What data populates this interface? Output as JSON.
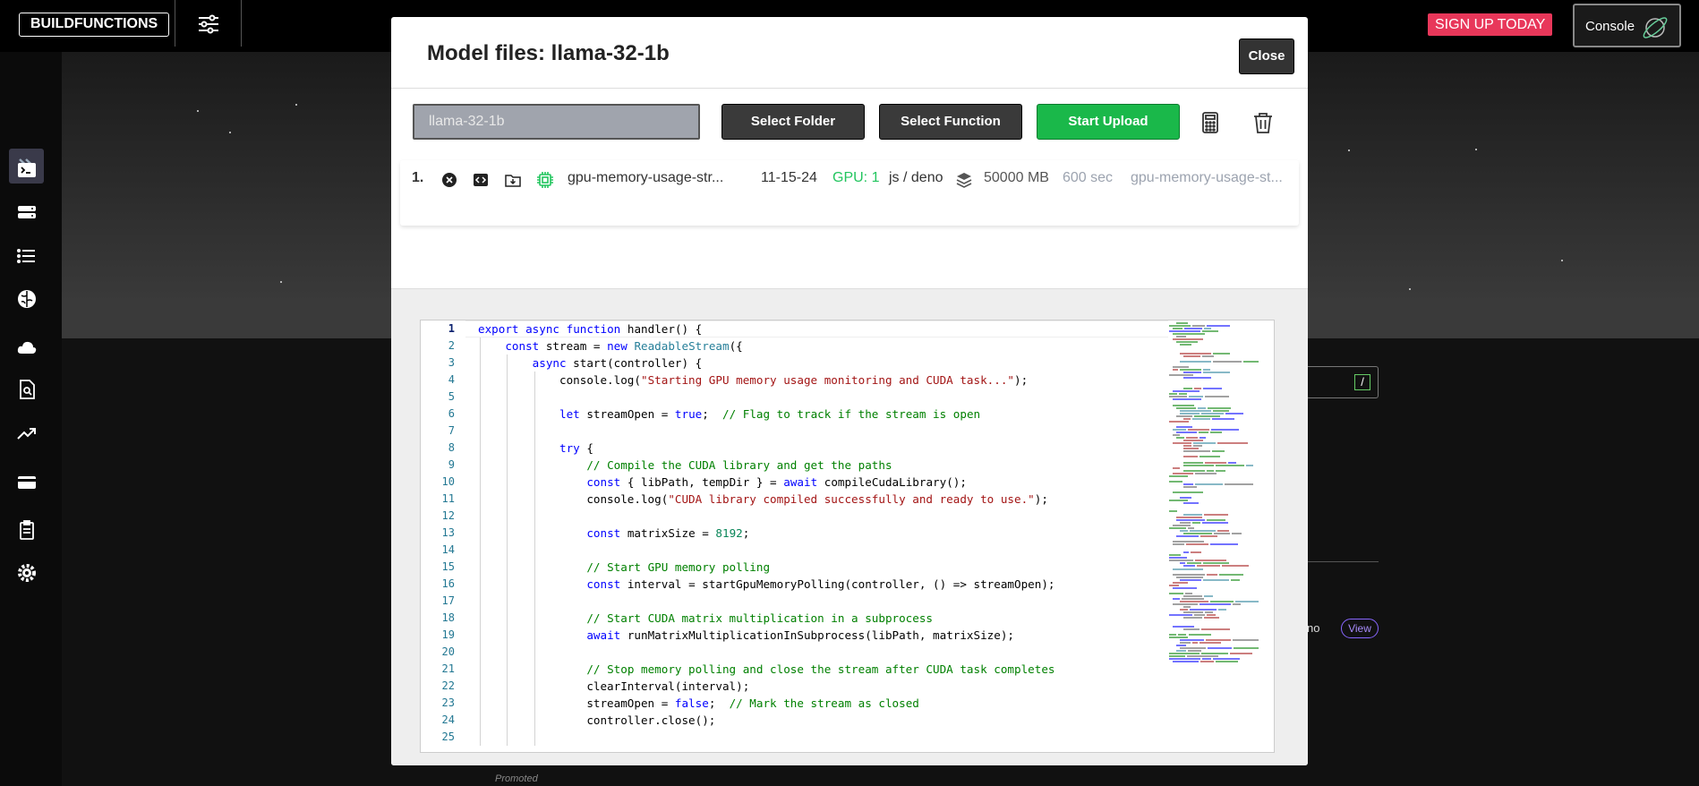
{
  "app": {
    "brand": "BUILDFUNCTIONS",
    "signup_label": "SIGN UP TODAY",
    "console_label": "Console",
    "bg_view_label": "View",
    "bg_runtime_fragment": "no",
    "bg_promoted": "Promoted",
    "bg_slash": "/"
  },
  "sidebar": {
    "icons": [
      "terminal-icon",
      "server-icon",
      "list-icon",
      "brain-icon",
      "cloud-icon",
      "file-search-icon",
      "trending-icon",
      "credit-card-icon",
      "clipboard-icon",
      "gear-icon"
    ]
  },
  "modal": {
    "title": "Model files: llama-32-1b",
    "close_label": "Close",
    "name_value": "llama-32-1b",
    "select_folder_label": "Select Folder",
    "select_function_label": "Select Function",
    "start_upload_label": "Start Upload",
    "file": {
      "index": "1.",
      "name": "gpu-memory-usage-str...",
      "date": "11-15-24",
      "gpu": "GPU: 1",
      "runtime": "js / deno",
      "memory": "50000 MB",
      "timeout": "600 sec",
      "function_name": "gpu-memory-usage-st..."
    },
    "editor": {
      "line_numbers": [
        "1",
        "2",
        "3",
        "4",
        "5",
        "6",
        "7",
        "8",
        "9",
        "10",
        "11",
        "12",
        "13",
        "14",
        "15",
        "16",
        "17",
        "18",
        "19",
        "20",
        "21",
        "22",
        "23",
        "24",
        "25"
      ],
      "lines": [
        "export async function handler() {",
        "    const stream = new ReadableStream({",
        "        async start(controller) {",
        "            console.log(\"Starting GPU memory usage monitoring and CUDA task...\");",
        "",
        "            let streamOpen = true;  // Flag to track if the stream is open",
        "",
        "            try {",
        "                // Compile the CUDA library and get the paths",
        "                const { libPath, tempDir } = await compileCudaLibrary();",
        "                console.log(\"CUDA library compiled successfully and ready to use.\");",
        "",
        "                const matrixSize = 8192;",
        "",
        "                // Start GPU memory polling",
        "                const interval = startGpuMemoryPolling(controller, () => streamOpen);",
        "",
        "                // Start CUDA matrix multiplication in a subprocess",
        "                await runMatrixMultiplicationInSubprocess(libPath, matrixSize);",
        "",
        "                // Stop memory polling and close the stream after CUDA task completes",
        "                clearInterval(interval);",
        "                streamOpen = false;  // Mark the stream as closed",
        "                controller.close();",
        ""
      ]
    }
  },
  "colors": {
    "signup": "#e8375a",
    "upload_green": "#1ab84a",
    "gpu_green": "#22c55e",
    "keyword": "#0000ff",
    "string": "#a31515",
    "comment": "#008000",
    "number": "#098658",
    "type": "#267f99",
    "line_number": "#237893"
  }
}
